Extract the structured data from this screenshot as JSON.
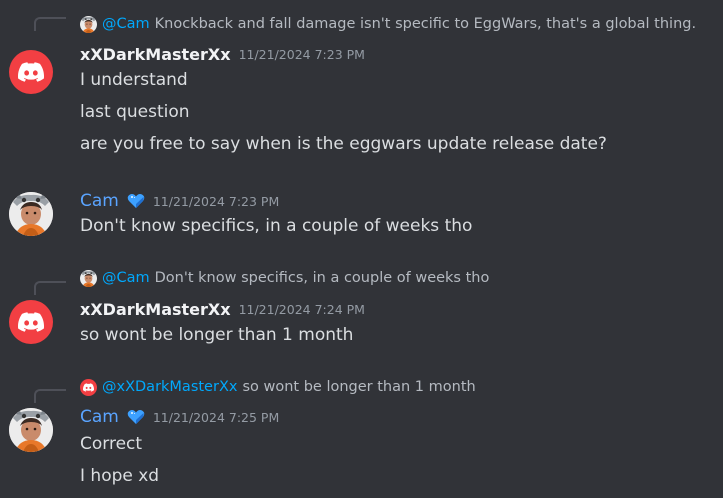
{
  "messages": [
    {
      "reply": {
        "mention": "@Cam",
        "text": "Knockback and fall damage isn't specific to EggWars, that's a global thing."
      },
      "username": "xXDarkMasterXx",
      "timestamp": "11/21/2024 7:23 PM",
      "lines": [
        "I  understand",
        "last question",
        "are you free to say when is the eggwars update release date?"
      ]
    },
    {
      "username": "Cam",
      "timestamp": "11/21/2024 7:23 PM",
      "lines": [
        "Don't know specifics, in a couple of weeks tho"
      ]
    },
    {
      "reply": {
        "mention": "@Cam",
        "text": "Don't know specifics, in a couple of weeks tho"
      },
      "username": "xXDarkMasterXx",
      "timestamp": "11/21/2024 7:24 PM",
      "lines": [
        "so wont be longer than 1 month"
      ]
    },
    {
      "reply": {
        "mention": "@xXDarkMasterXx",
        "text": "so wont be longer than 1 month"
      },
      "username": "Cam",
      "timestamp": "11/21/2024 7:25 PM",
      "lines": [
        "Correct",
        "I hope xd"
      ]
    }
  ],
  "colors": {
    "background": "#313338",
    "mention": "#00a8fc",
    "cam_name": "#5aa4ff",
    "discord_red": "#f23f43"
  },
  "icons": [
    "discord-avatar-icon",
    "cam-avatar",
    "blue-heart-icon"
  ]
}
